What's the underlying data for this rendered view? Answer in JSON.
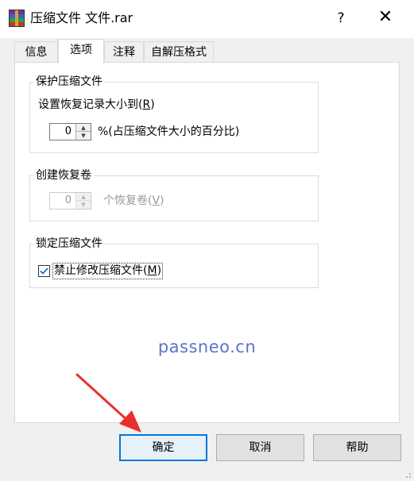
{
  "window": {
    "title": "压缩文件 文件.rar",
    "help_glyph": "?",
    "close_glyph": "✕"
  },
  "tabs": [
    {
      "label": "信息",
      "active": false
    },
    {
      "label": "选项",
      "active": true
    },
    {
      "label": "注释",
      "active": false
    },
    {
      "label": "自解压格式",
      "active": false
    }
  ],
  "protect_group": {
    "title": "保护压缩文件",
    "recovery_record_label": "设置恢复记录大小到(",
    "recovery_record_hotkey": "R",
    "recovery_record_suffix": ")",
    "spinner_value": "0",
    "percent_text": "%(占压缩文件大小的百分比)"
  },
  "recovery_group": {
    "title": "创建恢复卷",
    "spinner_value": "0",
    "volume_label": "个恢复卷(",
    "volume_hotkey": "V",
    "volume_suffix": ")",
    "disabled": true
  },
  "lock_group": {
    "title": "锁定压缩文件",
    "checkbox_label": "禁止修改压缩文件(",
    "checkbox_hotkey": "M",
    "checkbox_suffix": ")",
    "checked": true
  },
  "watermark": "passneo.cn",
  "buttons": {
    "ok": "确定",
    "cancel": "取消",
    "help": "帮助"
  },
  "colors": {
    "accent": "#0078d7",
    "arrow": "#e8312a",
    "watermark": "#5b74c8",
    "dialog_bg": "#f0f0f0"
  },
  "icons": {
    "app": "winrar-icon",
    "help": "question-mark-icon",
    "close": "close-icon",
    "check": "checkmark-icon",
    "spin_up": "spin-up-arrow-icon",
    "spin_down": "spin-down-arrow-icon"
  }
}
